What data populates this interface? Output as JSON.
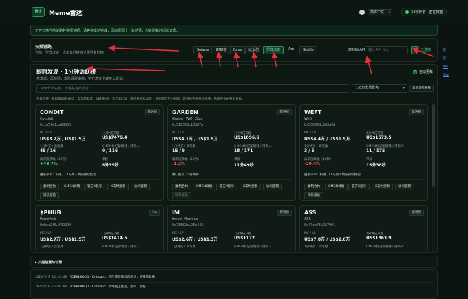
{
  "header": {
    "logo_text": "雷达",
    "title": "Meme雷达",
    "language": "简体中文",
    "status": "34秒钟前 · 正在扫描"
  },
  "notice": "正在扫描当前链路并整理证据。请等待本轮完成，页面保留上一轮结果，但会刷新时间和证据。",
  "scan": {
    "title": "扫描链路",
    "subtitle": "当前：罗宾汉链 · 点击其他链收立即重新扫描",
    "chains": [
      "Solana",
      "BNB链",
      "Base",
      "以太坊",
      "罗宾汉链",
      "Arc",
      "Stable"
    ],
    "active_chain": "罗宾汉链",
    "api_label": "GMGN API",
    "api_placeholder": "输入 API Key",
    "api_status": "已连接",
    "get_api": "获取 API Key"
  },
  "main": {
    "title": "即时发现 · 1分钟活跃榜",
    "subtitle": "先发现，再核验，本阶段是审核，不代表安全或买入建议。",
    "auto_refresh": "自动更新",
    "search_placeholder": "搜索代币名称，或粘贴合约地址",
    "sort": "1-8万市值优先",
    "refresh_btn": "复制流行查看",
    "status_line": "罗宾汉链 · 目标每20秒刷新；实际新鲜度：18秒钟前 · 显示15/38 · 跟流号目标发现 · 仅页面可见时刷新；新进榜不会重新排序，热度不会被安全分数。"
  },
  "cards": [
    {
      "name": "CONDIT",
      "full": "Conduit",
      "addr": "0x1a57e1…a98663",
      "badge": "新进榜",
      "mc_label": "MC / LP",
      "mc": "US$3.2万 / US$1.5万",
      "vol_label": "1分钟成交额",
      "vol": "US$7476.4",
      "tx_label": "1分钟买 / 卖笔数",
      "tx": "49 / 16",
      "holders_label": "GMGN标记聪明钱 / 持有人",
      "holders": "0 / 116",
      "change_label": "再次涨跌幅（10秒）",
      "change": "+48.7%",
      "change_type": "up",
      "age_label": "币龄",
      "age": "6分39秒",
      "note": "由来深审：权限、LP与真人情况持续核验",
      "actions": [
        "复制合约",
        "GMGN详情",
        "官方X账号",
        "X实时搜索",
        "访问官网",
        "排队核验"
      ]
    },
    {
      "name": "GARDEN",
      "full": "Garden With Eliza",
      "addr": "0x518563…130d7a",
      "badge": "新进榜",
      "mc_label": "MC / LP",
      "mc": "US$4.1万 / US$1.9万",
      "vol_label": "1分钟成交额",
      "vol": "US$1896.6",
      "tx_label": "1分钟买 / 卖笔数",
      "tx": "16 / 9",
      "holders_label": "GMGN标记聪明钱 / 持有人",
      "holders": "18 / 171",
      "change_label": "再次涨跌幅（10秒）",
      "change": "-2.2%",
      "change_type": "down",
      "age_label": "币龄",
      "age": "11分49秒",
      "note": "硬门槛良 · 5分钟榜",
      "actions": [
        "复制合约",
        "GMGN详情",
        "官方X账号",
        "X实时搜索",
        "访问官网",
        "排队核验"
      ]
    },
    {
      "name": "WEFT",
      "full": "Weft",
      "addr": "0x530348…8d3a5d",
      "badge": "新进榜",
      "mc_label": "MC / LP",
      "mc": "US$4.4万 / US$1.9万",
      "vol_label": "1分钟成交额",
      "vol": "US$1573.5",
      "tx_label": "1分钟买 / 卖笔数",
      "tx": "3 / 5",
      "holders_label": "GMGN标记聪明钱 / 持有人",
      "holders": "11 / 175",
      "change_label": "再次涨跌幅（10秒）",
      "change": "-20.4%",
      "change_type": "down",
      "age_label": "币龄",
      "age": "15分38秒",
      "note": "由来深审：权限、LP与真人情况持续核验",
      "actions": [
        "复制合约",
        "GMGN详情",
        "官方X账号",
        "X实时搜索",
        "访问官网",
        "排队核验"
      ]
    },
    {
      "name": "$PHUB",
      "full": "PonorHub",
      "addr": "0xbec2f5…f99999",
      "badge": "1m",
      "mc_label": "MC / LP",
      "mc": "US$2.7万 / US$1.5万",
      "vol_label": "1分钟成交额",
      "vol": "US$1414.5",
      "tx_label": "1分钟买 / 卖笔数",
      "holders_label": "GMGN标记聪明钱 / 持有人"
    },
    {
      "name": "IM",
      "full": "Invest Machine",
      "addr": "0x73682c…96b442",
      "badge": "新进榜",
      "mc_label": "MC / LP",
      "mc": "US$2.6万 / US$1.3万",
      "vol_label": "1分钟成交额",
      "vol": "US$1172",
      "tx_label": "1分钟买 / 卖笔数",
      "holders_label": "GMGN标记聪明钱 / 持有人"
    },
    {
      "name": "ASS",
      "full": "ASS",
      "addr": "0x47cb7f…687901",
      "badge": "新进榜",
      "mc_label": "MC / LP",
      "mc": "US$7.8万 / US$2.6万",
      "vol_label": "1分钟成交额",
      "vol": "US$1863.9",
      "tx_label": "1分钟买 / 卖笔数",
      "holders_label": "GMGN标记聪明钱 / 持有人"
    }
  ],
  "settings": "▸ 扫描设置与记录",
  "logs": [
    {
      "ts": "2026/9/9 16:14:49",
      "src": "ROBINHOOD · Onboard:",
      "msg": "风险或证据状态恶化，请重新复核"
    },
    {
      "ts": "2026/9/9 16:00:00",
      "src": "ROBINHOOD · Onboard:",
      "msg": "新增链上候选，需人工复核"
    }
  ],
  "colors": {
    "accent": "#2ee07a",
    "up": "#3ee083",
    "down": "#ff4d5a",
    "link": "#4f8cff",
    "annotation": "#e0303a"
  }
}
